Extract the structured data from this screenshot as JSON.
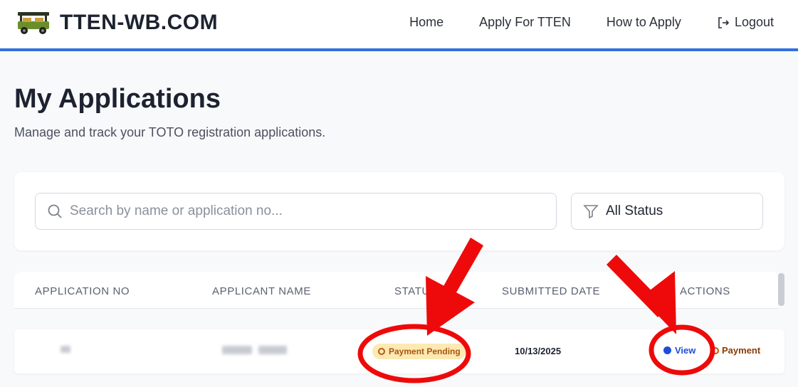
{
  "brand": {
    "name": "TTEN-WB.COM",
    "logo_icon": "e-rickshaw-icon"
  },
  "nav": {
    "home": "Home",
    "apply": "Apply For TTEN",
    "how_to": "How to Apply",
    "logout": "Logout"
  },
  "page": {
    "title": "My Applications",
    "subtitle": "Manage and track your TOTO registration applications."
  },
  "filters": {
    "search_placeholder": "Search by name or application no...",
    "status_value": "All Status"
  },
  "table": {
    "columns": [
      "APPLICATION NO",
      "APPLICANT NAME",
      "STATUS",
      "SUBMITTED DATE",
      "ACTIONS"
    ],
    "rows": [
      {
        "application_no": "",
        "applicant_name": "",
        "status": "Payment Pending",
        "submitted_date": "10/13/2025",
        "actions": [
          "View",
          "Payment"
        ]
      }
    ]
  },
  "colors": {
    "accent": "#2f6fe0",
    "annotation": "#ee0a0a",
    "badge_bg": "#fde9b4",
    "badge_text": "#a8560a",
    "link": "#1d4ed8"
  }
}
